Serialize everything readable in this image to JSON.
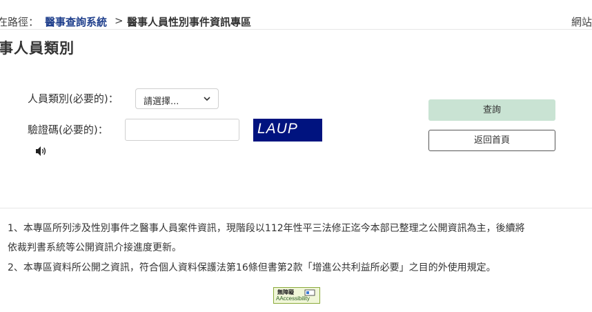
{
  "breadcrumb": {
    "prefix": "在路徑：",
    "link": "醫事查詢系統",
    "separator": ">",
    "current": "醫事人員性別事件資訊專區",
    "site_link": "網站"
  },
  "page_title": "事人員類別",
  "form": {
    "type_label": "人員類別(必要的)：",
    "type_select_value": "請選擇...",
    "captcha_label": "驗證碼(必要的)：",
    "captcha_value": "",
    "captcha_image_text": "LAUP"
  },
  "buttons": {
    "query": "查詢",
    "home": "返回首頁"
  },
  "notes": {
    "n1": "1、本專區所列涉及性別事件之醫事人員案件資訊，現階段以112年性平三法修正迄今本部已整理之公開資訊為主，後續將",
    "n1b": "依裁判書系統等公開資訊介接進度更新。",
    "n2": "2、本專區資料所公開之資訊，符合個人資料保護法第16條但書第2款「增進公共利益所必要」之目的外使用規定。"
  },
  "accessibility_badge": {
    "top": "無障礙",
    "bottom": "AAccessibility"
  },
  "icons": [
    "chevron-down-icon",
    "speaker-icon",
    "accessibility-badge-icon"
  ],
  "colors": {
    "link": "#1f3f8c",
    "captcha_bg": "#00137f",
    "query_button_bg": "#c9e3d3"
  }
}
